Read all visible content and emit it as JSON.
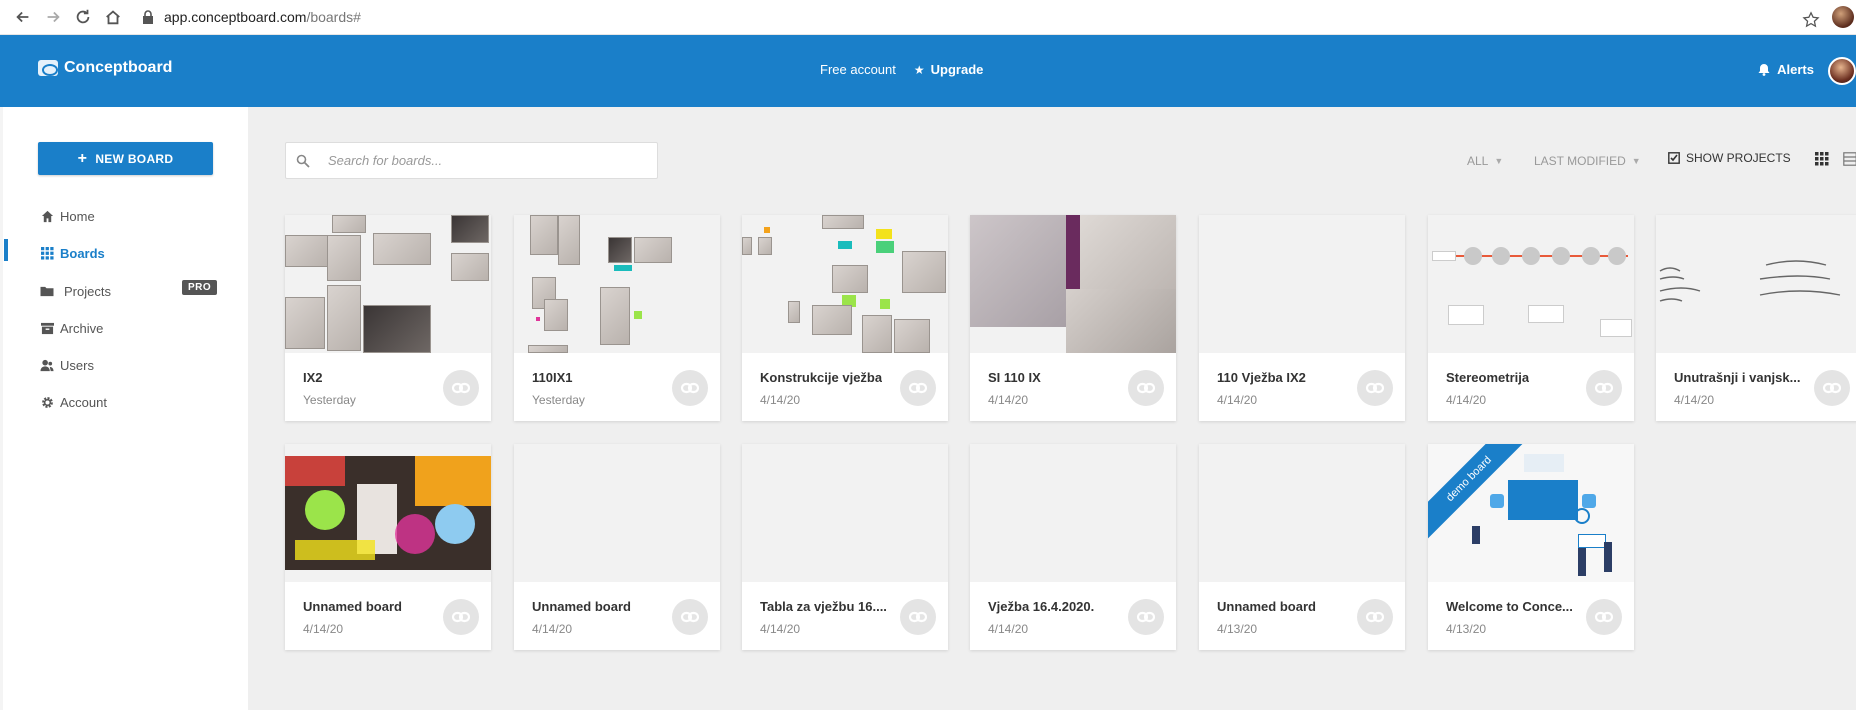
{
  "browser": {
    "url_host": "app.conceptboard.com",
    "url_path": "/boards#"
  },
  "header": {
    "brand": "Conceptboard",
    "free_account": "Free account",
    "upgrade": "Upgrade",
    "alerts": "Alerts"
  },
  "sidebar": {
    "new_board": "NEW BOARD",
    "items": [
      {
        "label": "Home",
        "icon": "home-icon"
      },
      {
        "label": "Boards",
        "icon": "grid-icon",
        "active": true
      },
      {
        "label": "Projects",
        "icon": "folder-icon",
        "badge": "PRO"
      },
      {
        "label": "Archive",
        "icon": "archive-icon"
      },
      {
        "label": "Users",
        "icon": "users-icon"
      },
      {
        "label": "Account",
        "icon": "gear-icon"
      }
    ]
  },
  "toolbar": {
    "search_placeholder": "Search for boards...",
    "filter_all": "ALL",
    "sort": "LAST MODIFIED",
    "show_projects": "SHOW PROJECTS"
  },
  "boards": [
    {
      "name": "IX2",
      "date": "Yesterday"
    },
    {
      "name": "110IX1",
      "date": "Yesterday"
    },
    {
      "name": "Konstrukcije vježba",
      "date": "4/14/20"
    },
    {
      "name": "SI 110 IX",
      "date": "4/14/20"
    },
    {
      "name": "110 Vježba IX2",
      "date": "4/14/20"
    },
    {
      "name": "Stereometrija",
      "date": "4/14/20"
    },
    {
      "name": "Unutrašnji i vanjsk...",
      "date": "4/14/20"
    },
    {
      "name": "Unnamed board",
      "date": "4/14/20"
    },
    {
      "name": "Unnamed board",
      "date": "4/14/20"
    },
    {
      "name": "Tabla za vježbu 16....",
      "date": "4/14/20"
    },
    {
      "name": "Vježba 16.4.2020.",
      "date": "4/14/20"
    },
    {
      "name": "Unnamed board",
      "date": "4/13/20"
    },
    {
      "name": "Welcome to Conce...",
      "date": "4/13/20",
      "ribbon": "demo board"
    }
  ],
  "colors": {
    "brand_blue": "#1a7fc9",
    "main_bg": "#efefef"
  }
}
